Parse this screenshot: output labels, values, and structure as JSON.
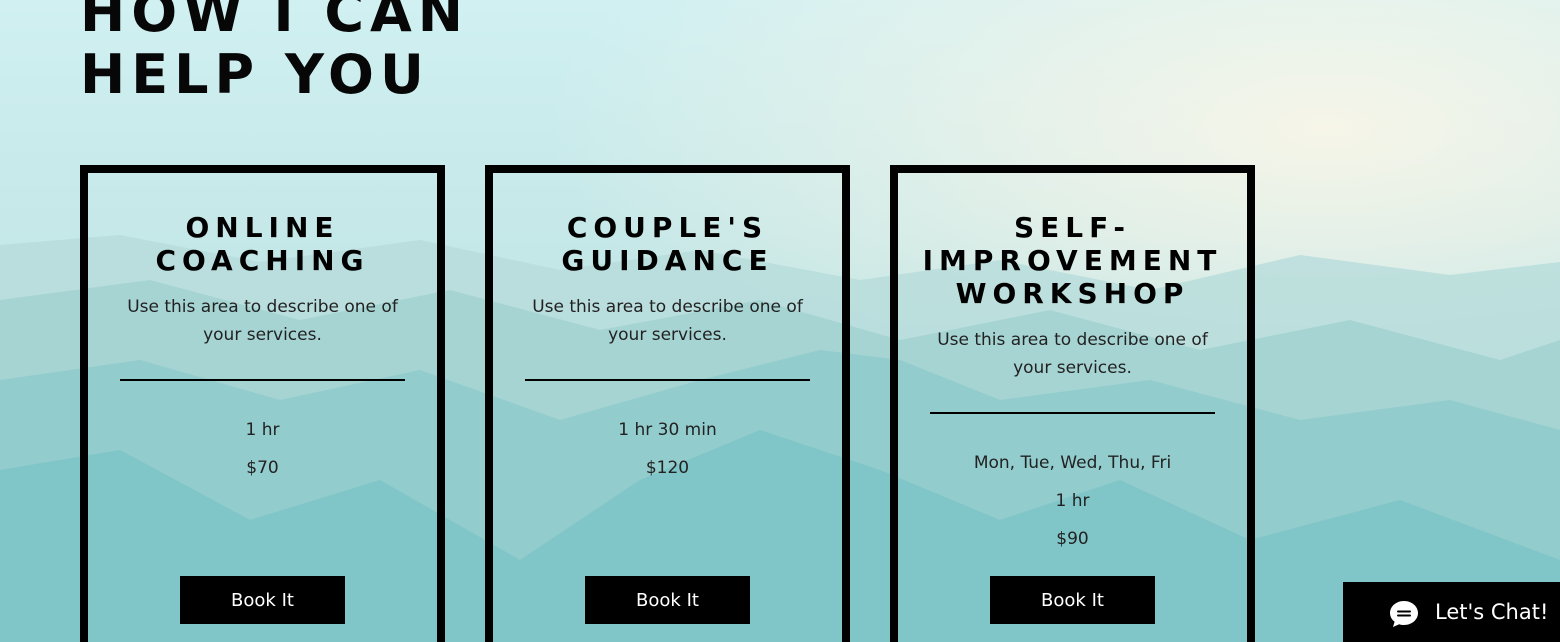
{
  "section": {
    "heading_line1": "HOW I CAN",
    "heading_line2": "HELP YOU"
  },
  "services": [
    {
      "title": "ONLINE COACHING",
      "description": "Use this area to describe one of your services.",
      "info": [
        "1 hr",
        "$70"
      ],
      "button": "Book It"
    },
    {
      "title": "COUPLE'S GUIDANCE",
      "description": "Use this area to describe one of your services.",
      "info": [
        "1 hr 30 min",
        "$120"
      ],
      "button": "Book It"
    },
    {
      "title": "SELF-IMPROVEMENT WORKSHOP",
      "description": "Use this area to describe one of your services.",
      "info": [
        "Mon, Tue, Wed, Thu, Fri",
        "1 hr",
        "$90"
      ],
      "button": "Book It"
    }
  ],
  "chat": {
    "label": "Let's Chat!",
    "icon": "chat-bubble-icon"
  },
  "colors": {
    "border": "#000000",
    "button_bg": "#000000",
    "button_text": "#ffffff"
  }
}
